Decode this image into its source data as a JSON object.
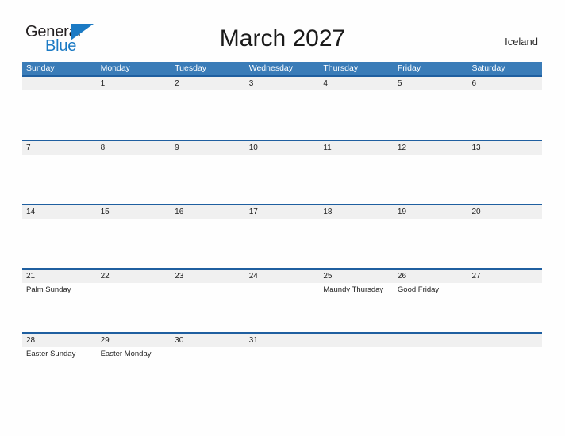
{
  "brand": {
    "name_part1": "General",
    "name_part2": "Blue",
    "mark": "triangle-flag-icon",
    "accent_color": "#1B7AC4"
  },
  "header": {
    "title": "March 2027",
    "region": "Iceland"
  },
  "theme": {
    "header_blue": "#3A7CB8",
    "row_border_blue": "#1F5FA0",
    "date_band_gray": "#F0F0F0",
    "page_background": "#FEFEFE",
    "text_color": "#222222"
  },
  "calendar": {
    "month": "March",
    "year": "2027",
    "weekday_headers": [
      "Sunday",
      "Monday",
      "Tuesday",
      "Wednesday",
      "Thursday",
      "Friday",
      "Saturday"
    ],
    "weeks": [
      {
        "dates": [
          "",
          "1",
          "2",
          "3",
          "4",
          "5",
          "6"
        ],
        "events": [
          "",
          "",
          "",
          "",
          "",
          "",
          ""
        ]
      },
      {
        "dates": [
          "7",
          "8",
          "9",
          "10",
          "11",
          "12",
          "13"
        ],
        "events": [
          "",
          "",
          "",
          "",
          "",
          "",
          ""
        ]
      },
      {
        "dates": [
          "14",
          "15",
          "16",
          "17",
          "18",
          "19",
          "20"
        ],
        "events": [
          "",
          "",
          "",
          "",
          "",
          "",
          ""
        ]
      },
      {
        "dates": [
          "21",
          "22",
          "23",
          "24",
          "25",
          "26",
          "27"
        ],
        "events": [
          "Palm Sunday",
          "",
          "",
          "",
          "Maundy Thursday",
          "Good Friday",
          ""
        ]
      },
      {
        "dates": [
          "28",
          "29",
          "30",
          "31",
          "",
          "",
          ""
        ],
        "events": [
          "Easter Sunday",
          "Easter Monday",
          "",
          "",
          "",
          "",
          ""
        ]
      }
    ]
  }
}
